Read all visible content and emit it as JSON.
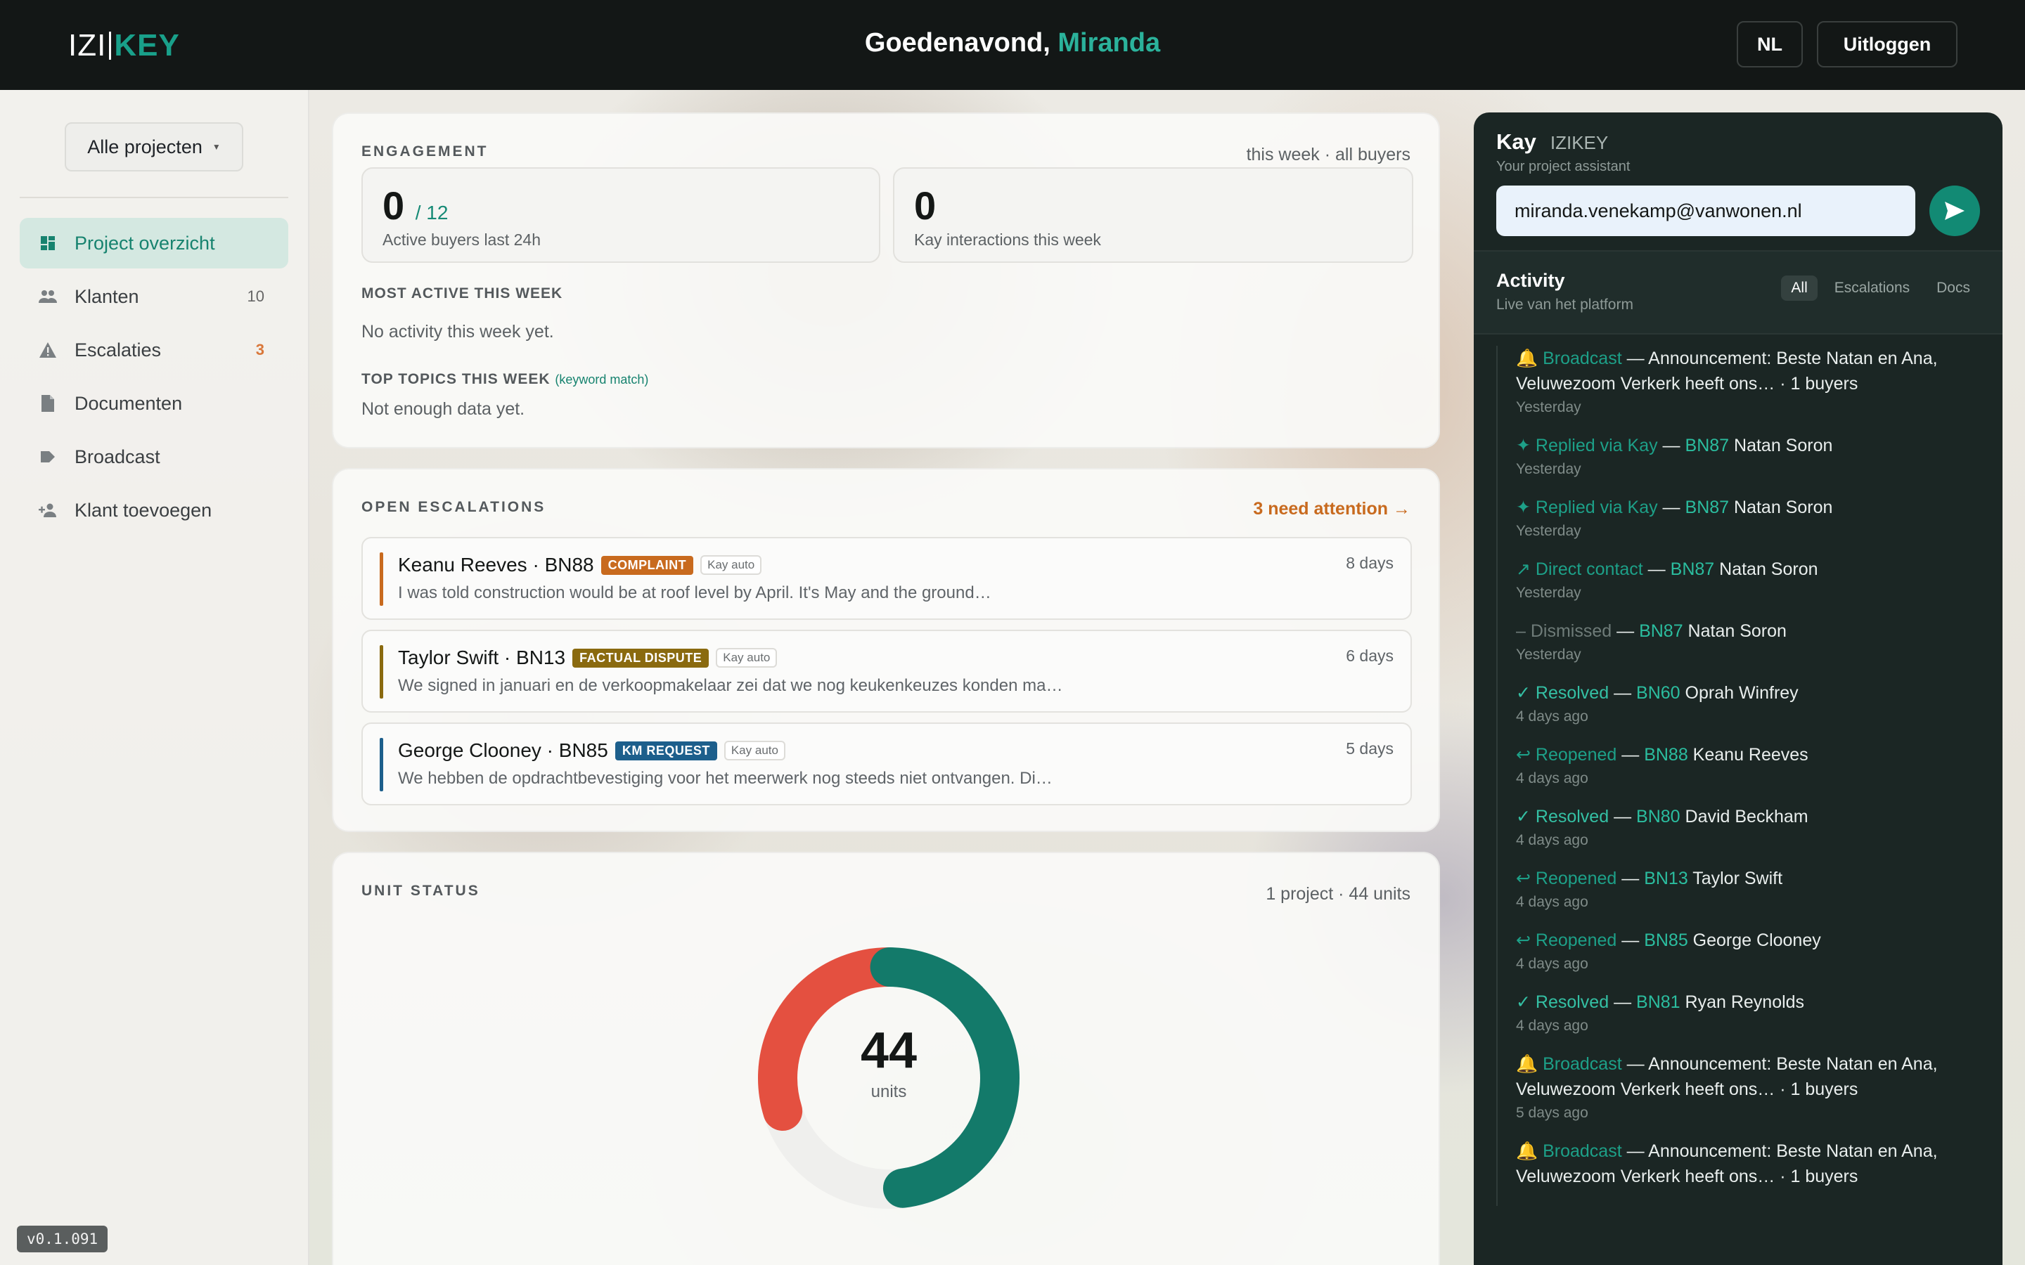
{
  "header": {
    "logo_left": "IZI",
    "logo_right": "KEY",
    "greeting_prefix": "Goedenavond,",
    "greeting_name": "Miranda",
    "lang_button": "NL",
    "logout_button": "Uitloggen"
  },
  "sidebar": {
    "project_select": "Alle projecten",
    "items": [
      {
        "label": "Project overzicht",
        "icon": "dashboard-icon",
        "count": ""
      },
      {
        "label": "Klanten",
        "icon": "people-icon",
        "count": "10"
      },
      {
        "label": "Escalaties",
        "icon": "warning-icon",
        "count": "3"
      },
      {
        "label": "Documenten",
        "icon": "document-icon",
        "count": ""
      },
      {
        "label": "Broadcast",
        "icon": "broadcast-icon",
        "count": ""
      },
      {
        "label": "Klant toevoegen",
        "icon": "add-person-icon",
        "count": ""
      }
    ],
    "version": "v0.1.091"
  },
  "engagement": {
    "label": "ENGAGEMENT",
    "scope": "this week · all buyers",
    "active_buyers": "0",
    "active_buyers_total": "/ 12",
    "active_buyers_caption": "Active buyers last 24h",
    "kay_interactions": "0",
    "kay_interactions_caption": "Kay interactions this week",
    "most_active_label": "MOST ACTIVE THIS WEEK",
    "most_active_text": "No activity this week yet.",
    "topics_label": "TOP TOPICS THIS WEEK",
    "topics_note": "(keyword match)",
    "topics_text": "Not enough data yet."
  },
  "escalations": {
    "label": "OPEN ESCALATIONS",
    "attention": "3 need attention →",
    "rows": [
      {
        "who": "Keanu Reeves · BN88",
        "tag": "COMPLAINT",
        "kay": "Kay auto",
        "days": "8 days",
        "msg": "I was told construction would be at roof level by April. It's May and the ground…",
        "accent": "#c86a1e"
      },
      {
        "who": "Taylor Swift · BN13",
        "tag": "FACTUAL DISPUTE",
        "kay": "Kay auto",
        "days": "6 days",
        "msg": "We signed in januari en de verkoopmakelaar zei dat we nog keukenkeuzes konden ma…",
        "accent": "#8a6a0f"
      },
      {
        "who": "George Clooney · BN85",
        "tag": "KM REQUEST",
        "kay": "Kay auto",
        "days": "5 days",
        "msg": "We hebben de opdrachtbevestiging voor het meerwerk nog steeds niet ontvangen. Di…",
        "accent": "#1d5f8c"
      }
    ]
  },
  "unit_status": {
    "label": "UNIT STATUS",
    "scope": "1 project · 44 units",
    "total": "44",
    "total_caption": "units",
    "segments": [
      {
        "fraction": 0.3,
        "color": "#e45040"
      },
      {
        "fraction": 0.22,
        "color": "#efefed"
      },
      {
        "fraction": 0.48,
        "color": "#137a6a"
      }
    ]
  },
  "kay": {
    "name": "Kay",
    "brand": "IZIKEY",
    "subtitle": "Your project assistant",
    "input_value": "miranda.venekamp@vanwonen.nl",
    "activity_title": "Activity",
    "activity_sub": "Live van het platform",
    "filters": [
      "All",
      "Escalations",
      "Docs"
    ],
    "activity": [
      {
        "kind": "🔔 Broadcast",
        "cls": "",
        "unit": "",
        "text": " — Announcement: Beste Natan en Ana, Veluwezoom Verkerk heeft ons… · 1 buyers",
        "time": "Yesterday"
      },
      {
        "kind": "✦ Replied via Kay",
        "cls": "",
        "unit": "BN87",
        "text": " Natan Soron",
        "time": "Yesterday"
      },
      {
        "kind": "✦ Replied via Kay",
        "cls": "",
        "unit": "BN87",
        "text": " Natan Soron",
        "time": "Yesterday"
      },
      {
        "kind": "↗ Direct contact",
        "cls": "",
        "unit": "BN87",
        "text": " Natan Soron",
        "time": "Yesterday"
      },
      {
        "kind": "– Dismissed",
        "cls": "dim",
        "unit": "BN87",
        "text": " Natan Soron",
        "time": "Yesterday"
      },
      {
        "kind": "✓ Resolved",
        "cls": "ok",
        "unit": "BN60",
        "text": " Oprah Winfrey",
        "time": "4 days ago"
      },
      {
        "kind": "↩ Reopened",
        "cls": "",
        "unit": "BN88",
        "text": " Keanu Reeves",
        "time": "4 days ago"
      },
      {
        "kind": "✓ Resolved",
        "cls": "ok",
        "unit": "BN80",
        "text": " David Beckham",
        "time": "4 days ago"
      },
      {
        "kind": "↩ Reopened",
        "cls": "",
        "unit": "BN13",
        "text": " Taylor Swift",
        "time": "4 days ago"
      },
      {
        "kind": "↩ Reopened",
        "cls": "",
        "unit": "BN85",
        "text": " George Clooney",
        "time": "4 days ago"
      },
      {
        "kind": "✓ Resolved",
        "cls": "ok",
        "unit": "BN81",
        "text": " Ryan Reynolds",
        "time": "4 days ago"
      },
      {
        "kind": "🔔 Broadcast",
        "cls": "",
        "unit": "",
        "text": " — Announcement: Beste Natan en Ana, Veluwezoom Verkerk heeft ons… · 1 buyers",
        "time": "5 days ago"
      },
      {
        "kind": "🔔 Broadcast",
        "cls": "",
        "unit": "",
        "text": " — Announcement: Beste Natan en Ana, Veluwezoom Verkerk heeft ons… · 1 buyers",
        "time": ""
      }
    ]
  }
}
